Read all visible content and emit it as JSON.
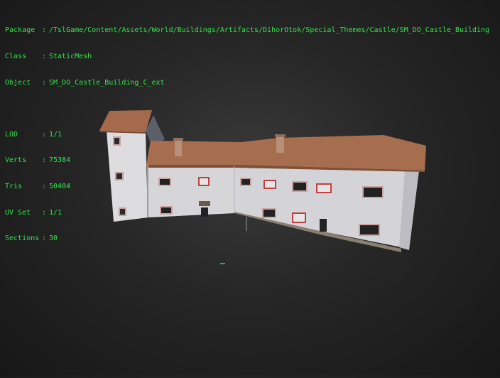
{
  "info": {
    "package_label": "Package",
    "package_value": "/TslGame/Content/Assets/World/Buildings/Artifacts/DihorOtok/Special_Themes/Castle/SM_DO_Castle_Building",
    "class_label": "Class",
    "class_value": "StaticMesh",
    "object_label": "Object",
    "object_value": "SM_DO_Castle_Building_C_ext",
    "lod_label": "LOD",
    "lod_value": "1/1",
    "verts_label": "Verts",
    "verts_value": "75384",
    "tris_label": "Tris",
    "tris_value": "50404",
    "uvset_label": "UV Set",
    "uvset_value": "1/1",
    "sections_label": "Sections",
    "sections_value": "30",
    "separator": ":"
  },
  "colors": {
    "text": "#35e24a",
    "wall": "#d8d8da",
    "roof": "#a86c4e",
    "background": "#262626"
  }
}
